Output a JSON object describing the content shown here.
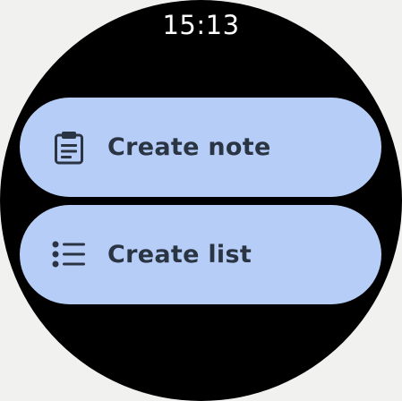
{
  "status_bar": {
    "time": "15:13"
  },
  "actions": [
    {
      "label": "Create note",
      "icon": "clipboard-note-icon"
    },
    {
      "label": "Create list",
      "icon": "bulleted-list-icon"
    }
  ],
  "colors": {
    "background": "#f1f2f0",
    "watch_face": "#000000",
    "chip_background": "#b6cdf7",
    "chip_foreground": "#2b3443",
    "time_text": "#ffffff"
  }
}
